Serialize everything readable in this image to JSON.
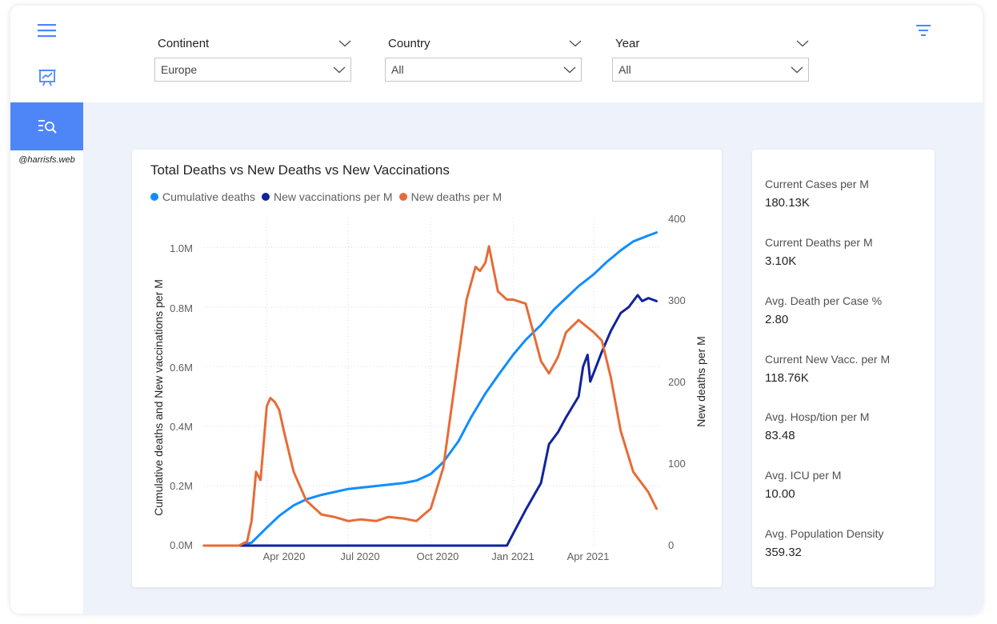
{
  "credit": "@harrisfs.web",
  "filters": [
    {
      "label": "Continent",
      "value": "Europe"
    },
    {
      "label": "Country",
      "value": "All"
    },
    {
      "label": "Year",
      "value": "All"
    }
  ],
  "chart": {
    "title": "Total Deaths vs New Deaths vs New Vaccinations",
    "legend": [
      {
        "name": "Cumulative deaths",
        "color": "#118dff"
      },
      {
        "name": "New vaccinations per M",
        "color": "#12239e"
      },
      {
        "name": "New deaths per M",
        "color": "#e66c37"
      }
    ],
    "y_left_label": "Cumulative deaths and New vaccinations per M",
    "y_right_label": "New deaths per M",
    "y_left_ticks": [
      "0.0M",
      "0.2M",
      "0.4M",
      "0.6M",
      "0.8M",
      "1.0M"
    ],
    "y_right_ticks": [
      "0",
      "100",
      "200",
      "300",
      "400"
    ],
    "x_ticks": [
      "Apr 2020",
      "Jul 2020",
      "Oct 2020",
      "Jan 2021",
      "Apr 2021"
    ]
  },
  "chart_data": {
    "type": "line",
    "title": "Total Deaths vs New Deaths vs New Vaccinations",
    "xlabel": "",
    "ylabel": "Cumulative deaths and New vaccinations per M",
    "y2label": "New deaths per M",
    "x_ticks": [
      "Apr 2020",
      "Jul 2020",
      "Oct 2020",
      "Jan 2021",
      "Apr 2021"
    ],
    "ylim": [
      0,
      1.1
    ],
    "y2lim": [
      0,
      400
    ],
    "legend_position": "top-left",
    "grid": true,
    "series": [
      {
        "name": "Cumulative deaths",
        "axis": "left",
        "unit": "M",
        "x": [
          "2020-01-22",
          "2020-03-01",
          "2020-03-15",
          "2020-04-01",
          "2020-04-15",
          "2020-05-01",
          "2020-05-15",
          "2020-06-01",
          "2020-07-01",
          "2020-08-01",
          "2020-09-01",
          "2020-09-15",
          "2020-10-01",
          "2020-10-15",
          "2020-11-01",
          "2020-11-15",
          "2020-12-01",
          "2020-12-15",
          "2021-01-01",
          "2021-01-15",
          "2021-02-01",
          "2021-02-15",
          "2021-03-01",
          "2021-03-15",
          "2021-04-01",
          "2021-04-15",
          "2021-05-01",
          "2021-05-15",
          "2021-06-01",
          "2021-06-10"
        ],
        "values": [
          0,
          0,
          0.01,
          0.06,
          0.1,
          0.135,
          0.155,
          0.17,
          0.19,
          0.2,
          0.21,
          0.218,
          0.24,
          0.28,
          0.35,
          0.43,
          0.51,
          0.57,
          0.64,
          0.69,
          0.74,
          0.79,
          0.83,
          0.87,
          0.91,
          0.95,
          0.99,
          1.02,
          1.04,
          1.05
        ]
      },
      {
        "name": "New vaccinations per M",
        "axis": "left",
        "unit": "M",
        "x": [
          "2020-01-22",
          "2020-12-25",
          "2021-01-01",
          "2021-01-15",
          "2021-02-01",
          "2021-02-10",
          "2021-02-20",
          "2021-03-01",
          "2021-03-15",
          "2021-03-20",
          "2021-03-25",
          "2021-03-28",
          "2021-04-01",
          "2021-04-10",
          "2021-04-20",
          "2021-05-01",
          "2021-05-10",
          "2021-05-20",
          "2021-05-25",
          "2021-06-01",
          "2021-06-10"
        ],
        "values": [
          0,
          0,
          0.04,
          0.12,
          0.21,
          0.34,
          0.38,
          0.43,
          0.5,
          0.6,
          0.64,
          0.55,
          0.58,
          0.65,
          0.72,
          0.78,
          0.8,
          0.84,
          0.82,
          0.83,
          0.82
        ]
      },
      {
        "name": "New deaths per M",
        "axis": "right",
        "unit": "per M",
        "x": [
          "2020-01-22",
          "2020-03-01",
          "2020-03-10",
          "2020-03-15",
          "2020-03-20",
          "2020-03-25",
          "2020-04-01",
          "2020-04-05",
          "2020-04-10",
          "2020-04-15",
          "2020-04-20",
          "2020-05-01",
          "2020-05-15",
          "2020-06-01",
          "2020-06-15",
          "2020-07-01",
          "2020-07-15",
          "2020-08-01",
          "2020-08-15",
          "2020-09-01",
          "2020-09-15",
          "2020-10-01",
          "2020-10-15",
          "2020-11-01",
          "2020-11-10",
          "2020-11-20",
          "2020-11-25",
          "2020-12-01",
          "2020-12-05",
          "2020-12-15",
          "2020-12-25",
          "2021-01-01",
          "2021-01-15",
          "2021-02-01",
          "2021-02-10",
          "2021-02-20",
          "2021-03-01",
          "2021-03-15",
          "2021-04-01",
          "2021-04-10",
          "2021-04-20",
          "2021-05-01",
          "2021-05-15",
          "2021-06-01",
          "2021-06-10"
        ],
        "values": [
          0,
          0,
          5,
          30,
          90,
          80,
          170,
          180,
          175,
          165,
          140,
          90,
          55,
          38,
          35,
          30,
          32,
          30,
          35,
          33,
          30,
          45,
          95,
          230,
          300,
          340,
          335,
          345,
          365,
          310,
          300,
          300,
          295,
          225,
          210,
          230,
          260,
          275,
          260,
          250,
          205,
          140,
          90,
          65,
          45
        ]
      }
    ]
  },
  "kpis": [
    {
      "label": "Current Cases per M",
      "value": "180.13K"
    },
    {
      "label": "Current Deaths per M",
      "value": "3.10K"
    },
    {
      "label": "Avg. Death per Case %",
      "value": "2.80"
    },
    {
      "label": "Current New Vacc. per M",
      "value": "118.76K"
    },
    {
      "label": "Avg. Hosp/tion per M",
      "value": "83.48"
    },
    {
      "label": "Avg. ICU per M",
      "value": "10.00"
    },
    {
      "label": "Avg. Population Density",
      "value": "359.32"
    }
  ],
  "icons": {
    "menu": "hamburger-icon",
    "report": "presentation-chart-icon",
    "explore": "search-list-icon",
    "filter": "filter-funnel-icon",
    "chevron": "chevron-down-icon"
  },
  "colors": {
    "accent": "#4f86f7",
    "background": "#eef2fa",
    "cumulative_deaths": "#118dff",
    "new_vaccinations": "#12239e",
    "new_deaths": "#e66c37"
  }
}
